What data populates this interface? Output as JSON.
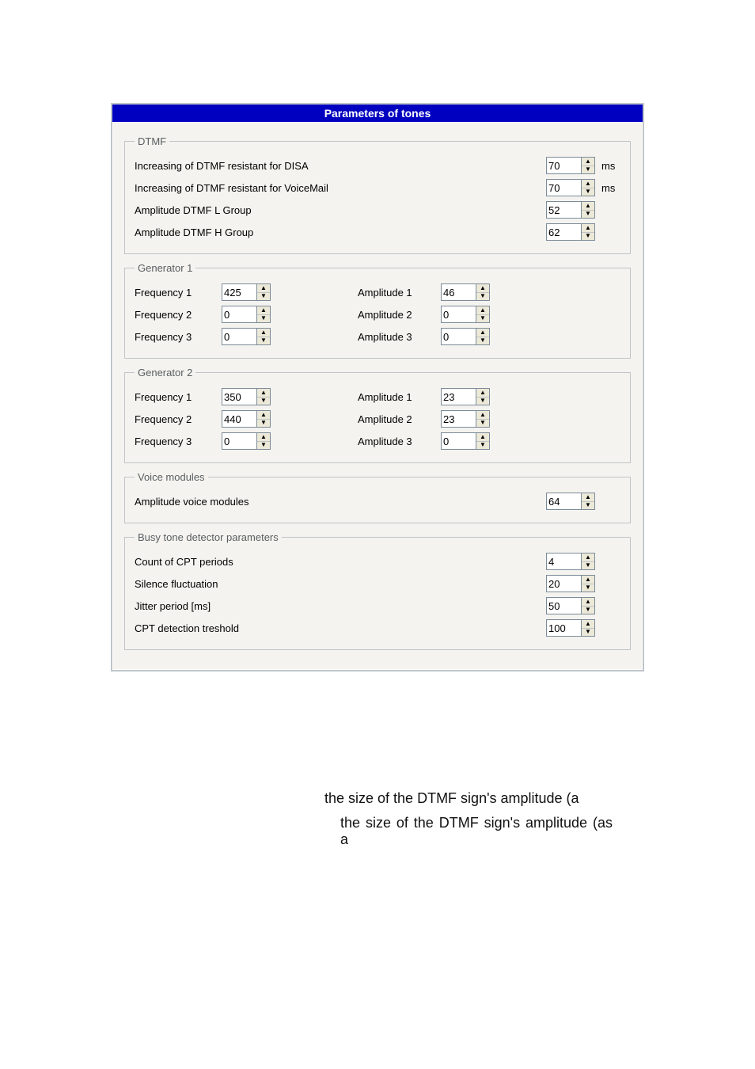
{
  "title": "Parameters of tones",
  "dtmf": {
    "legend": "DTMF",
    "rows": [
      {
        "label": "Increasing of DTMF resistant for DISA",
        "value": "70",
        "unit": "ms"
      },
      {
        "label": "Increasing of DTMF resistant for VoiceMail",
        "value": "70",
        "unit": "ms"
      },
      {
        "label": "Amplitude DTMF L Group",
        "value": "52",
        "unit": ""
      },
      {
        "label": "Amplitude DTMF H Group",
        "value": "62",
        "unit": ""
      }
    ]
  },
  "gen1": {
    "legend": "Generator 1",
    "rows": [
      {
        "flabel": "Frequency 1",
        "fval": "425",
        "alabel": "Amplitude 1",
        "aval": "46"
      },
      {
        "flabel": "Frequency 2",
        "fval": "0",
        "alabel": "Amplitude 2",
        "aval": "0"
      },
      {
        "flabel": "Frequency 3",
        "fval": "0",
        "alabel": "Amplitude 3",
        "aval": "0"
      }
    ]
  },
  "gen2": {
    "legend": "Generator 2",
    "rows": [
      {
        "flabel": "Frequency 1",
        "fval": "350",
        "alabel": "Amplitude 1",
        "aval": "23"
      },
      {
        "flabel": "Frequency 2",
        "fval": "440",
        "alabel": "Amplitude 2",
        "aval": "23"
      },
      {
        "flabel": "Frequency 3",
        "fval": "0",
        "alabel": "Amplitude 3",
        "aval": "0"
      }
    ]
  },
  "voice": {
    "legend": "Voice modules",
    "label": "Amplitude voice modules",
    "value": "64"
  },
  "busy": {
    "legend": "Busy tone detector parameters",
    "rows": [
      {
        "label": "Count of CPT periods",
        "value": "4"
      },
      {
        "label": "Silence fluctuation",
        "value": "20"
      },
      {
        "label": "Jitter period [ms]",
        "value": "50"
      },
      {
        "label": "CPT detection treshold",
        "value": "100"
      }
    ]
  },
  "body": {
    "line1": "the size of the DTMF sign's amplitude (a",
    "line2": "the size of the DTMF sign's amplitude (as a"
  },
  "glyph": {
    "up": "▲",
    "down": "▼"
  }
}
